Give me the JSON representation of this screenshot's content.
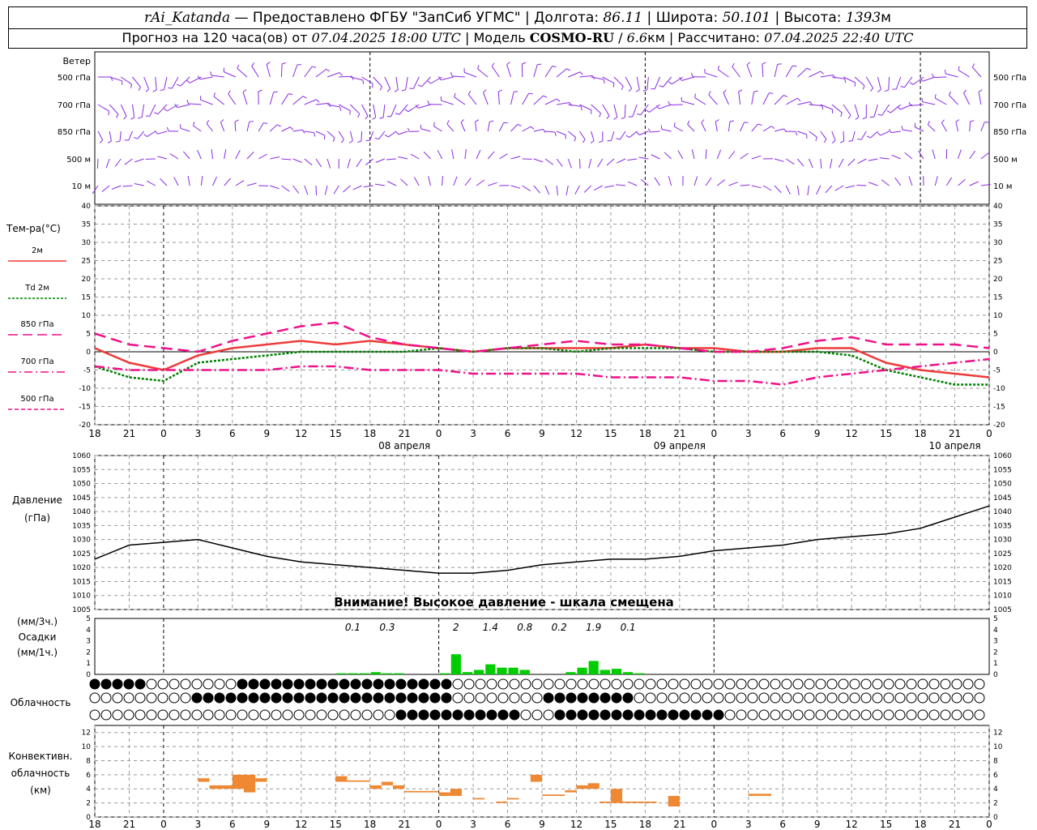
{
  "header": {
    "station": "rAi_Katanda",
    "dash": " — ",
    "provider": "Предоставлено ФГБУ \"ЗапСиб УГМС\"",
    "lon_label": "Долгота:",
    "lon_value": "86.11",
    "lat_label": "Широта:",
    "lat_value": "50.101",
    "alt_label": "Высота:",
    "alt_value": "1393",
    "alt_unit": "м",
    "sep": " | ",
    "forecast_prefix": "Прогноз на 120 часа(ов) от",
    "forecast_time": "07.04.2025 18:00 UTC",
    "model_label": "Модель",
    "model_name": "COSMO-RU",
    "model_res": "6.6",
    "model_res_unit": "км",
    "calc_label": "Рассчитано:",
    "calc_time": "07.04.2025 22:40 UTC"
  },
  "labels": {
    "wind_title": "Ветер",
    "wind_levels": [
      "500 гПа",
      "700 гПа",
      "850 гПа",
      "500 м",
      "10  м"
    ],
    "temp_title": "Тем-ра(°С)",
    "temp_legend": [
      "2м",
      "Td  2м",
      "850 гПа",
      "700 гПа",
      "500 гПа"
    ],
    "pressure_title": [
      "Давление",
      "(гПа)"
    ],
    "pressure_warning": "Внимание! Высокое давление - шкала смещена",
    "precip_title": [
      "(мм/3ч.)",
      "Осадки",
      "(мм/1ч.)"
    ],
    "cloud_title": "Облачность",
    "conv_title": [
      "Конвективн.",
      "облачность",
      "(км)"
    ]
  },
  "colors": {
    "t2m": "#ee3b3b",
    "td2m": "#008000",
    "t850": "#ee1188",
    "t700": "#ee1188",
    "t500": "#ee1188",
    "wind": "#8a2be2",
    "precip": "#00cc00",
    "conv": "#ee8833",
    "grid": "#999999"
  },
  "chart_data": [
    {
      "type": "line",
      "panel": "temperature",
      "ylabel": "Тем-ра(°С)",
      "ylim": [
        -20,
        40
      ],
      "y_ticks": [
        -20,
        -15,
        -10,
        -5,
        0,
        5,
        10,
        15,
        20,
        25,
        30,
        35,
        40
      ],
      "x_ticks": [
        "18",
        "21",
        "0",
        "3",
        "6",
        "9",
        "12",
        "15",
        "18",
        "21",
        "0",
        "3",
        "6",
        "9",
        "12",
        "15",
        "18",
        "21",
        "0",
        "3",
        "6",
        "9",
        "12",
        "15",
        "18",
        "21",
        "0"
      ],
      "date_labels": [
        "08 апреля",
        "09 апреля",
        "10 апреля"
      ],
      "grid": true,
      "x_hours": [
        0,
        3,
        6,
        9,
        12,
        15,
        18,
        21,
        24,
        27,
        30,
        33,
        36,
        39,
        42,
        45,
        48,
        51,
        54,
        57,
        60,
        63,
        66,
        69,
        72,
        75,
        78
      ],
      "series": [
        {
          "name": "2м",
          "style": "solid",
          "values": [
            1,
            -3,
            -5,
            -1,
            1,
            2,
            3,
            2,
            3,
            2,
            1,
            0,
            1,
            1,
            1,
            1,
            2,
            1,
            1,
            0,
            0,
            1,
            1,
            -3,
            -5,
            -6,
            -7
          ]
        },
        {
          "name": "Td  2м",
          "style": "dotted",
          "values": [
            -4,
            -7,
            -8,
            -3,
            -2,
            -1,
            0,
            0,
            0,
            0,
            1,
            0,
            1,
            1,
            0,
            1,
            1,
            1,
            0,
            0,
            0,
            0,
            -1,
            -5,
            -7,
            -9,
            -9
          ]
        },
        {
          "name": "850 гПа",
          "style": "dash",
          "values": [
            5,
            2,
            1,
            0,
            3,
            5,
            7,
            8,
            4,
            2,
            1,
            0,
            1,
            2,
            3,
            2,
            2,
            1,
            0,
            0,
            1,
            3,
            4,
            2,
            2,
            2,
            1
          ]
        },
        {
          "name": "700 гПа",
          "style": "dashdot",
          "values": [
            -4,
            -5,
            -5,
            -5,
            -5,
            -5,
            -4,
            -4,
            -5,
            -5,
            -5,
            -6,
            -6,
            -6,
            -6,
            -7,
            -7,
            -7,
            -8,
            -8,
            -9,
            -7,
            -6,
            -5,
            -4,
            -3,
            -2
          ]
        }
      ]
    },
    {
      "type": "line",
      "panel": "pressure",
      "ylabel": "Давление (гПа)",
      "ylim": [
        1005,
        1060
      ],
      "y_ticks": [
        1005,
        1010,
        1015,
        1020,
        1025,
        1030,
        1035,
        1040,
        1045,
        1050,
        1055,
        1060
      ],
      "grid": true,
      "x_hours": [
        0,
        3,
        6,
        9,
        12,
        15,
        18,
        21,
        24,
        27,
        30,
        33,
        36,
        39,
        42,
        45,
        48,
        51,
        54,
        57,
        60,
        63,
        66,
        69,
        72,
        75,
        78
      ],
      "series": [
        {
          "name": "",
          "values": [
            1023,
            1028,
            1029,
            1030,
            1027,
            1024,
            1022,
            1021,
            1020,
            1019,
            1018,
            1018,
            1019,
            1021,
            1022,
            1023,
            1023,
            1024,
            1026,
            1027,
            1028,
            1030,
            1031,
            1032,
            1034,
            1038,
            1042
          ]
        }
      ]
    },
    {
      "type": "bar",
      "panel": "precipitation",
      "ylabel": "Осадки",
      "ylim": [
        0,
        5
      ],
      "y_ticks": [
        0,
        1,
        2,
        3,
        4,
        5
      ],
      "totals_3h": [
        "0.1",
        "0.3",
        "2",
        "1.4",
        "0.8",
        "0.2",
        "1.9",
        "0.1"
      ],
      "bars_hourly": [
        {
          "h": 21,
          "v": 0.1
        },
        {
          "h": 22,
          "v": 0.1
        },
        {
          "h": 23,
          "v": 0.1
        },
        {
          "h": 24,
          "v": 0.2
        },
        {
          "h": 25,
          "v": 0.1
        },
        {
          "h": 26,
          "v": 0.1
        },
        {
          "h": 30,
          "v": 0.1
        },
        {
          "h": 31,
          "v": 1.8
        },
        {
          "h": 32,
          "v": 0.2
        },
        {
          "h": 33,
          "v": 0.4
        },
        {
          "h": 34,
          "v": 0.9
        },
        {
          "h": 35,
          "v": 0.6
        },
        {
          "h": 36,
          "v": 0.6
        },
        {
          "h": 37,
          "v": 0.4
        },
        {
          "h": 41,
          "v": 0.2
        },
        {
          "h": 42,
          "v": 0.6
        },
        {
          "h": 43,
          "v": 1.2
        },
        {
          "h": 44,
          "v": 0.4
        },
        {
          "h": 45,
          "v": 0.5
        },
        {
          "h": 46,
          "v": 0.2
        },
        {
          "h": 47,
          "v": 0.1
        }
      ]
    },
    {
      "type": "bar",
      "panel": "convective_cloud",
      "ylabel": "Конвективн. облачность (км)",
      "ylim": [
        0,
        13
      ],
      "y_ticks": [
        0,
        2,
        4,
        6,
        8,
        10,
        12
      ],
      "segments": [
        {
          "h0": 9,
          "h1": 10,
          "base": 5,
          "top": 5.5
        },
        {
          "h0": 10,
          "h1": 12,
          "base": 4,
          "top": 4.5
        },
        {
          "h0": 12,
          "h1": 13,
          "base": 4,
          "top": 6
        },
        {
          "h0": 13,
          "h1": 14,
          "base": 3.5,
          "top": 6
        },
        {
          "h0": 14,
          "h1": 15,
          "base": 5,
          "top": 5.5
        },
        {
          "h0": 21,
          "h1": 22,
          "base": 5,
          "top": 5.8
        },
        {
          "h0": 22,
          "h1": 24,
          "base": 5,
          "top": 5.2
        },
        {
          "h0": 24,
          "h1": 25,
          "base": 4,
          "top": 4.5
        },
        {
          "h0": 25,
          "h1": 26,
          "base": 4.5,
          "top": 5
        },
        {
          "h0": 26,
          "h1": 27,
          "base": 4,
          "top": 4.5
        },
        {
          "h0": 27,
          "h1": 30,
          "base": 3.5,
          "top": 3.7
        },
        {
          "h0": 30,
          "h1": 31,
          "base": 3,
          "top": 3.5
        },
        {
          "h0": 31,
          "h1": 32,
          "base": 3,
          "top": 4
        },
        {
          "h0": 33,
          "h1": 34,
          "base": 2.5,
          "top": 2.7
        },
        {
          "h0": 35,
          "h1": 36,
          "base": 2,
          "top": 2.2
        },
        {
          "h0": 36,
          "h1": 37,
          "base": 2.5,
          "top": 2.7
        },
        {
          "h0": 38,
          "h1": 39,
          "base": 5,
          "top": 6
        },
        {
          "h0": 39,
          "h1": 41,
          "base": 3,
          "top": 3.2
        },
        {
          "h0": 41,
          "h1": 42,
          "base": 3.5,
          "top": 3.8
        },
        {
          "h0": 42,
          "h1": 43,
          "base": 4,
          "top": 4.5
        },
        {
          "h0": 43,
          "h1": 44,
          "base": 4,
          "top": 4.8
        },
        {
          "h0": 44,
          "h1": 45,
          "base": 2,
          "top": 2.2
        },
        {
          "h0": 45,
          "h1": 46,
          "base": 2,
          "top": 4
        },
        {
          "h0": 46,
          "h1": 49,
          "base": 2,
          "top": 2.2
        },
        {
          "h0": 50,
          "h1": 51,
          "base": 1.5,
          "top": 3
        },
        {
          "h0": 57,
          "h1": 59,
          "base": 3,
          "top": 3.3
        }
      ]
    }
  ]
}
